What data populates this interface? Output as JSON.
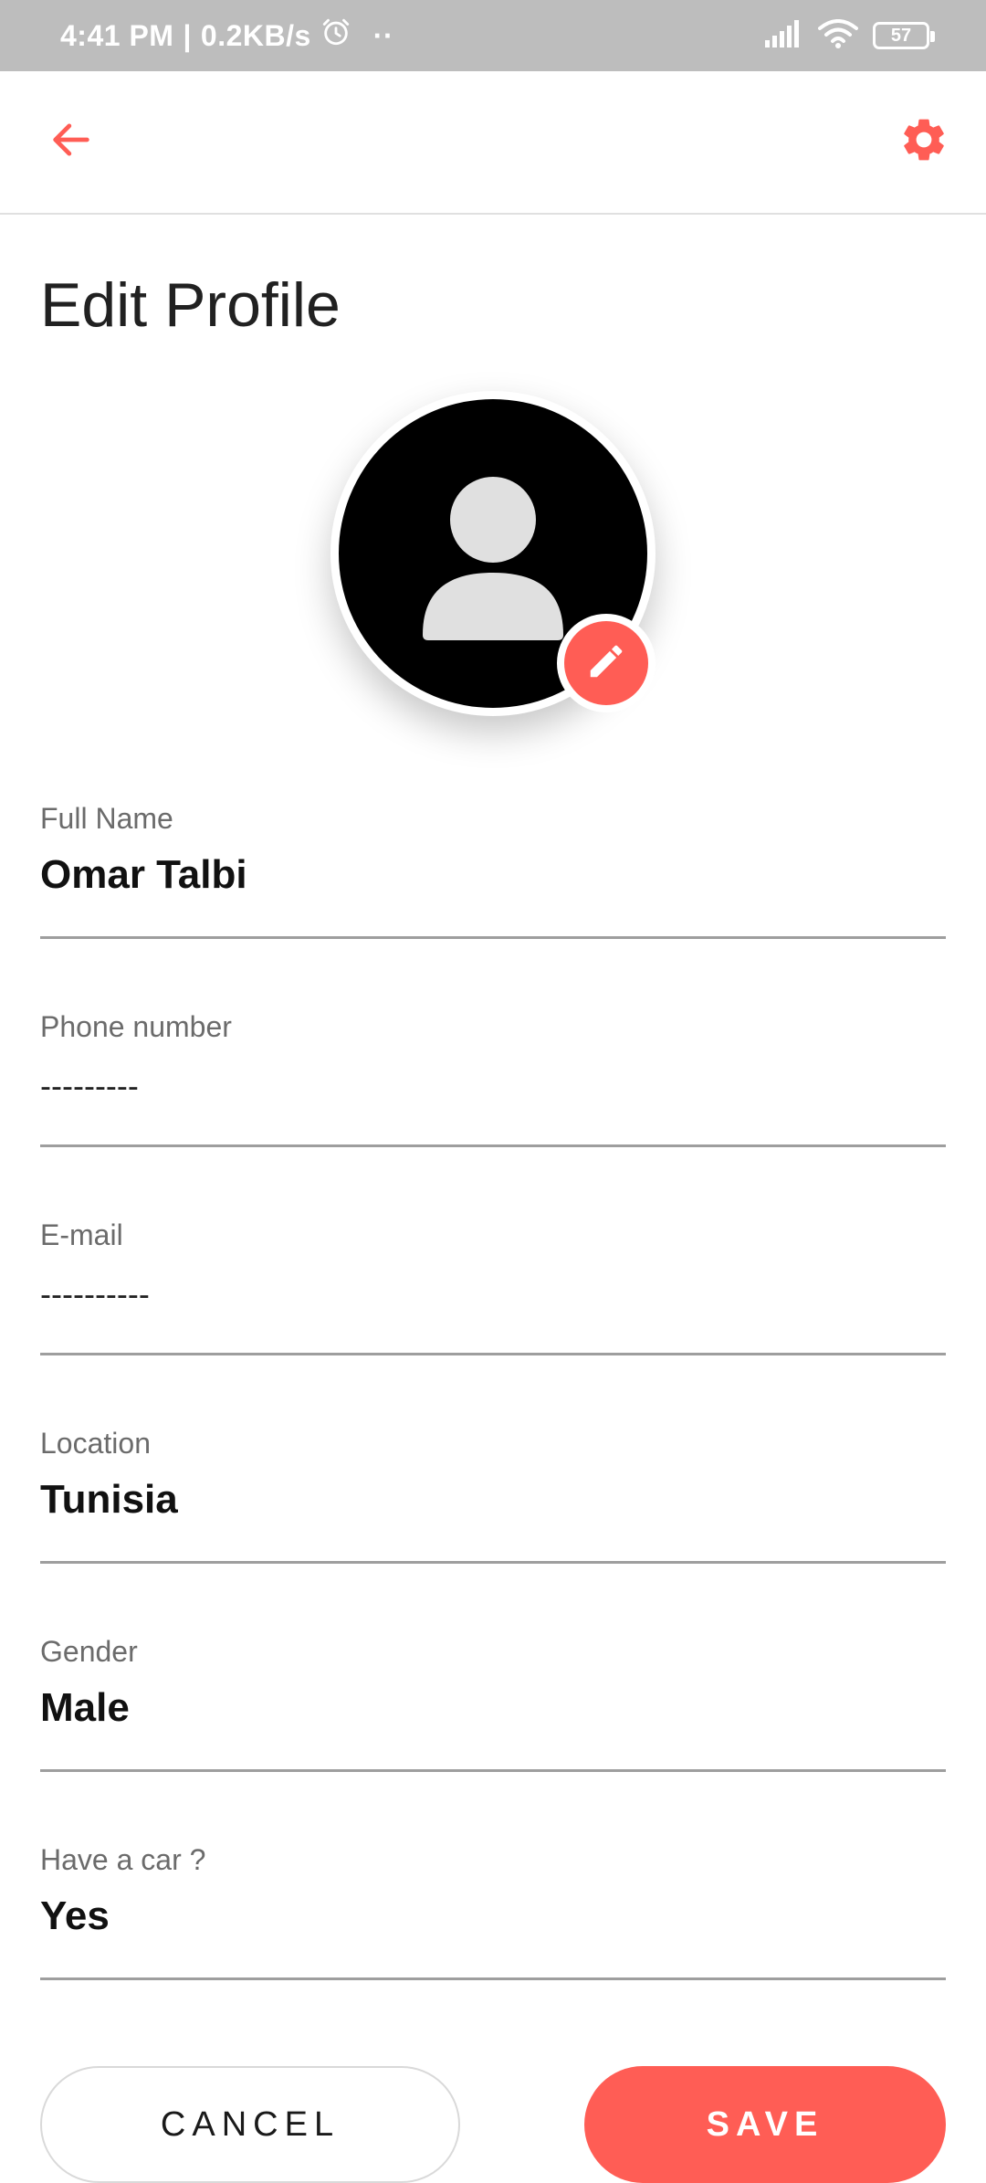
{
  "status_bar": {
    "time": "4:41 PM",
    "separator": "|",
    "speed": "0.2KB/s",
    "more": "··",
    "battery": "57"
  },
  "header": {
    "back_icon": "arrow-back-icon",
    "settings_icon": "gear-icon",
    "accent_color": "#ff5d55"
  },
  "page": {
    "title": "Edit Profile"
  },
  "avatar": {
    "icon": "person-icon",
    "edit_icon": "pencil-icon"
  },
  "fields": [
    {
      "label": "Full Name",
      "value": "Omar Talbi"
    },
    {
      "label": "Phone number",
      "value": "---------"
    },
    {
      "label": "E-mail",
      "value": "----------"
    },
    {
      "label": "Location",
      "value": "Tunisia"
    },
    {
      "label": "Gender",
      "value": "Male"
    },
    {
      "label": "Have a car ?",
      "value": "Yes"
    }
  ],
  "actions": {
    "cancel_label": "CANCEL",
    "save_label": "SAVE"
  }
}
